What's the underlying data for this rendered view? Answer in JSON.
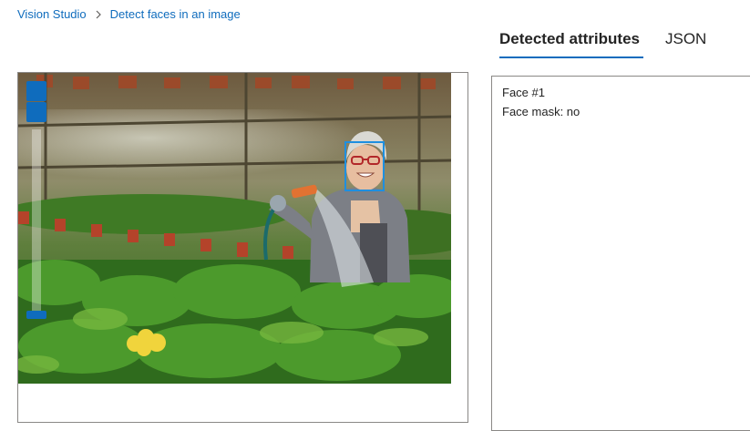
{
  "breadcrumb": {
    "home": "Vision Studio",
    "current": "Detect faces in an image"
  },
  "tabs": [
    {
      "label": "Detected attributes",
      "active": true
    },
    {
      "label": "JSON",
      "active": false
    }
  ],
  "results": [
    "Face #1",
    "Face mask: no"
  ],
  "colors": {
    "accent": "#0f6cbd",
    "face_box": "#1e8fe0"
  }
}
